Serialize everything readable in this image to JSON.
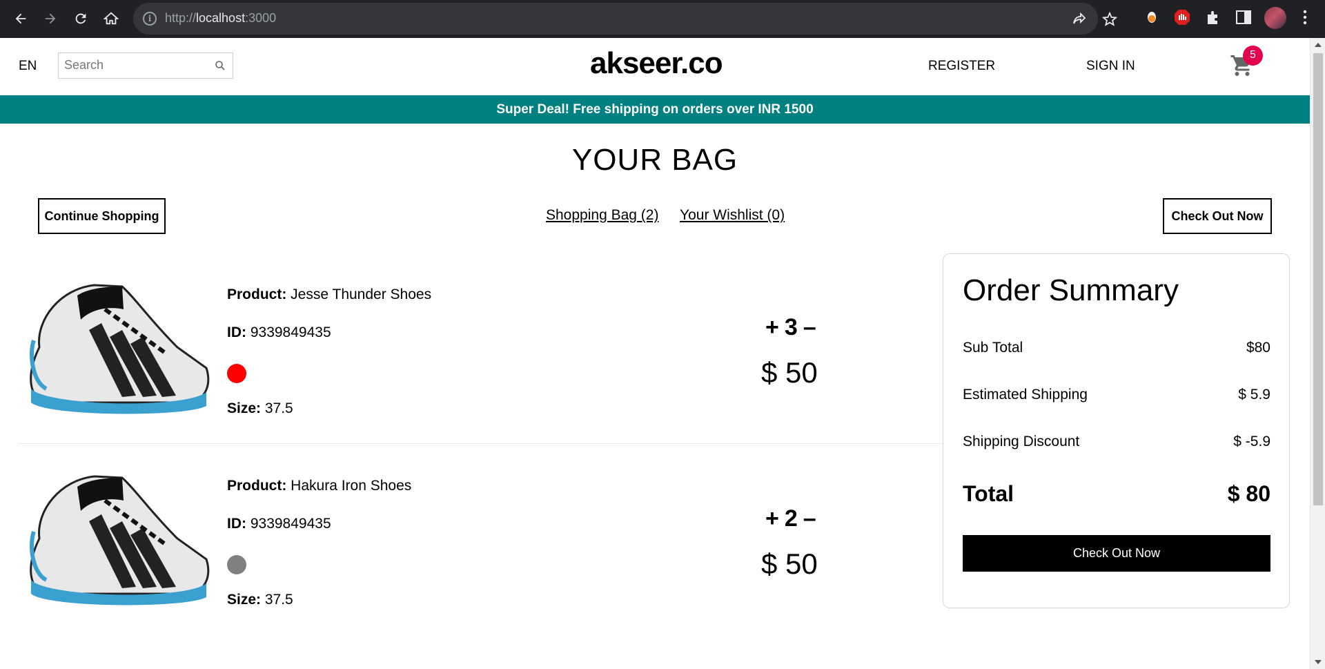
{
  "browser": {
    "url_host": "localhost",
    "url_prefix": "http://",
    "url_port": ":3000"
  },
  "header": {
    "language": "EN",
    "search_placeholder": "Search",
    "logo": "akseer.co",
    "register": "REGISTER",
    "sign_in": "SIGN IN",
    "cart_count": "5"
  },
  "announcement": "Super Deal! Free shipping on orders over INR 1500",
  "bag": {
    "title": "YOUR BAG",
    "continue_shopping": "Continue Shopping",
    "shopping_bag_link": "Shopping Bag (2)",
    "wishlist_link": "Your Wishlist (0)",
    "checkout_top": "Check Out Now"
  },
  "labels": {
    "product": "Product:",
    "id": "ID:",
    "size": "Size:"
  },
  "products": [
    {
      "name": "Jesse Thunder Shoes",
      "id": "9339849435",
      "color": "#ff0000",
      "size": "37.5",
      "quantity": "3",
      "price": "$ 50"
    },
    {
      "name": "Hakura Iron Shoes",
      "id": "9339849435",
      "color": "#808080",
      "size": "37.5",
      "quantity": "2",
      "price": "$ 50"
    }
  ],
  "qty_controls": {
    "plus": "+",
    "minus": "–"
  },
  "summary": {
    "title": "Order Summary",
    "subtotal_label": "Sub Total",
    "subtotal_value": "$80",
    "shipping_label": "Estimated Shipping",
    "shipping_value": "$ 5.9",
    "discount_label": "Shipping Discount",
    "discount_value": "$ -5.9",
    "total_label": "Total",
    "total_value": "$ 80",
    "checkout": "Check Out Now"
  },
  "colors": {
    "announcement_bg": "#008080",
    "cart_badge": "#e3004e",
    "chrome_bg": "#202124"
  }
}
